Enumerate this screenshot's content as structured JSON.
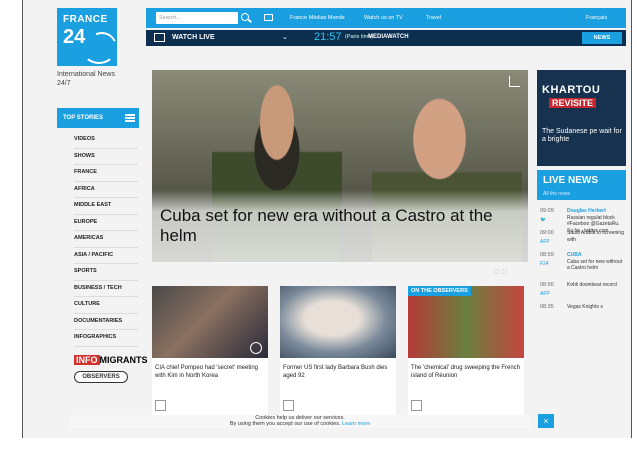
{
  "brand": {
    "line1": "FRANCE",
    "line2": "24",
    "tagline": "International News 24/7"
  },
  "topbar": {
    "search_placeholder": "Search...",
    "links": [
      "France Médias Monde",
      "Watch us on TV",
      "Travel",
      "Français"
    ]
  },
  "livebar": {
    "watch_label": "WATCH LIVE",
    "time": "21:57",
    "timezone": "(Paris time)",
    "program": "MEDIAWATCH",
    "news_tab": "NEWS"
  },
  "sidebar": {
    "top_stories": "TOP STORIES",
    "items": [
      "VIDEOS",
      "SHOWS",
      "FRANCE",
      "AFRICA",
      "MIDDLE EAST",
      "EUROPE",
      "AMERICAS",
      "ASIA / PACIFIC",
      "SPORTS",
      "BUSINESS / TECH",
      "CULTURE",
      "DOCUMENTARIES",
      "INFOGRAPHICS"
    ],
    "info_badge": "INFO",
    "migrants_badge": "MIGRANTS",
    "observers_badge": "OBSERVERS"
  },
  "hero": {
    "title": "Cuba set for new era without a Castro at the helm"
  },
  "cards": [
    {
      "caption": "CIA chief Pompeo had 'secret' meeting with Kim in North Korea",
      "label": ""
    },
    {
      "caption": "Former US first lady Barbara Bush dies aged 92",
      "label": ""
    },
    {
      "caption": "The 'chemical' drug sweeping the French island of Réunion",
      "label": "ON THE OBSERVERS"
    }
  ],
  "promo": {
    "title": "KHARTOU",
    "subtitle": "REVISITE",
    "desc": "The Sudanese pe wait for a brighte"
  },
  "live_news": {
    "heading": "LIVE NEWS",
    "subheading": "All the news",
    "items": [
      {
        "time": "09:09",
        "source": "",
        "head": "Douglas Herbert",
        "text": "Russian regulat block #Faceboo @GazetaRu. So be.. twitter com"
      },
      {
        "time": "09:00",
        "source": "AFP",
        "head": "",
        "text": "Saudi Arabia to screening with"
      },
      {
        "time": "08:59",
        "source": "F24",
        "head": "CUBA",
        "text": "Cuba set for new without a Castro helm"
      },
      {
        "time": "08:56",
        "source": "AFP",
        "head": "",
        "text": "Kohli downbeat record"
      },
      {
        "time": "08:35",
        "source": "",
        "head": "",
        "text": "Vegas Knights s"
      }
    ]
  },
  "cookie": {
    "line1": "Cookies help us deliver our services.",
    "line2": "By using them you accept our use of cookies.",
    "link": "Learn more"
  },
  "close_label": "×"
}
